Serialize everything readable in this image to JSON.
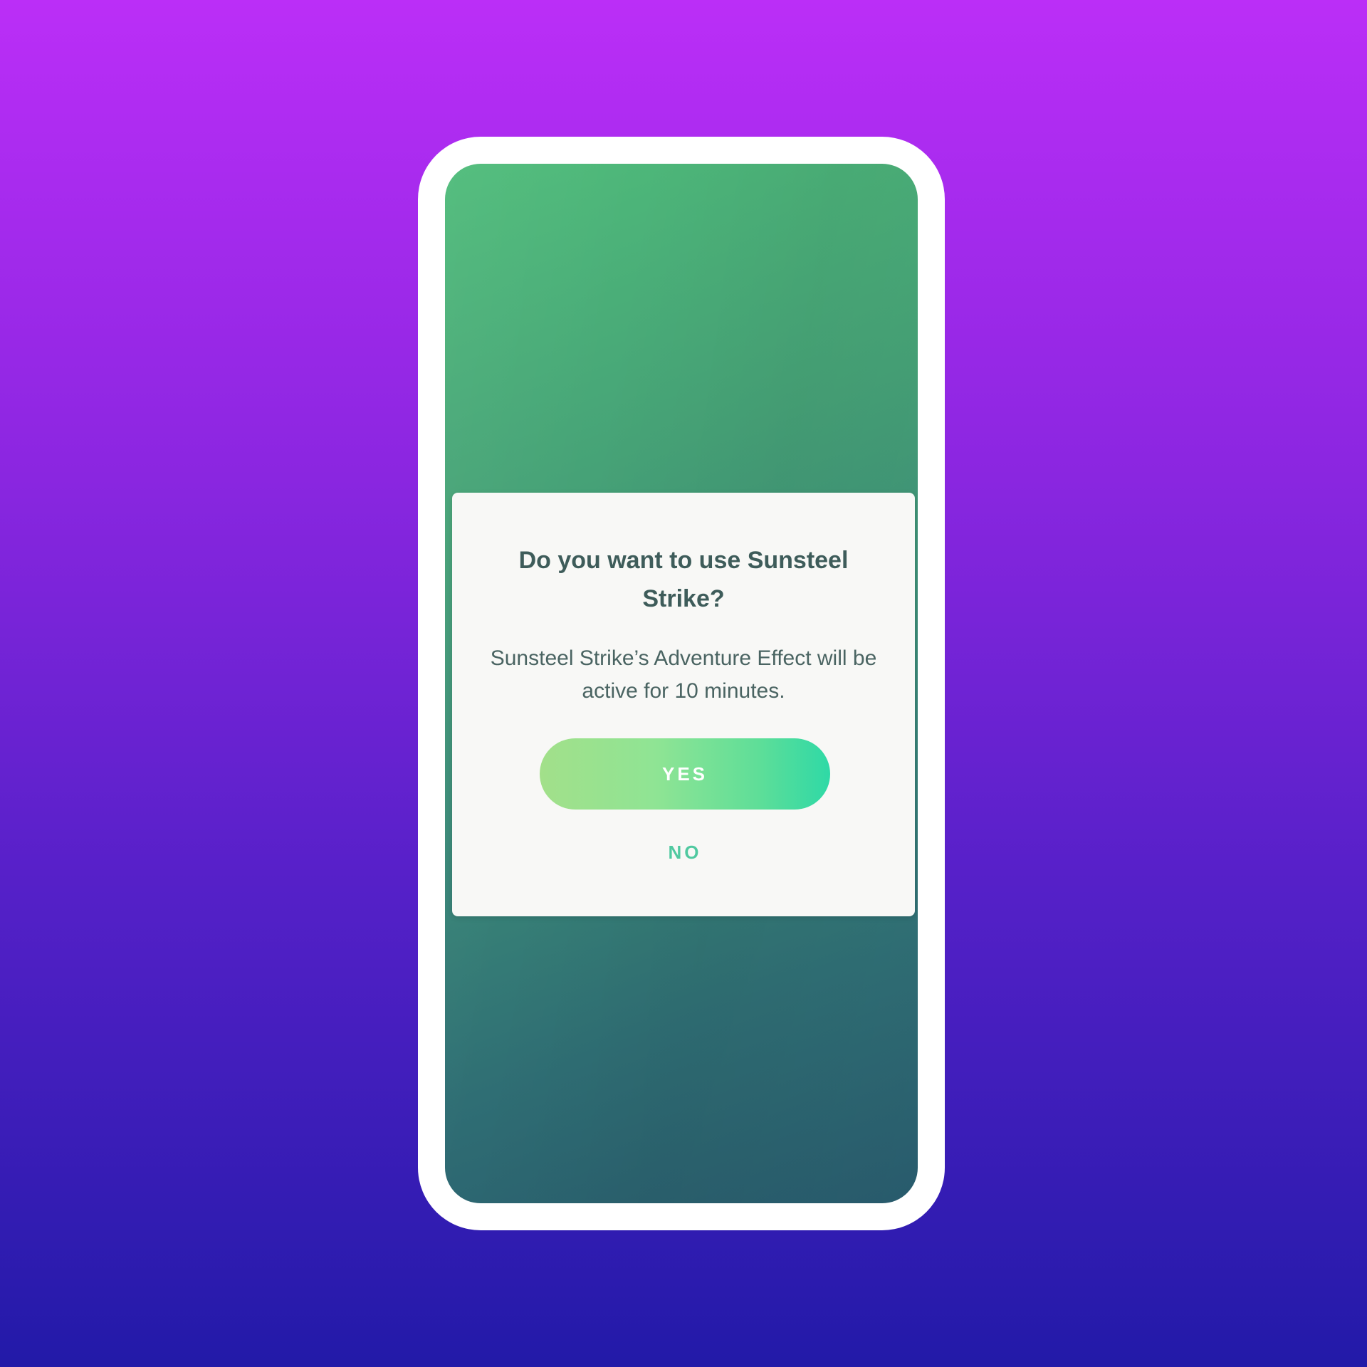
{
  "dialog": {
    "title": "Do you want to use Sunsteel Strike?",
    "body": "Sunsteel Strike’s Adventure Effect will be active for 10 minutes.",
    "confirm_label": "YES",
    "cancel_label": "NO"
  },
  "colors": {
    "background_top": "#bb2ef7",
    "background_bottom": "#221aa8",
    "screen_green": "#46a277",
    "dialog_bg": "#f8f8f6",
    "title_text": "#3e5c5a",
    "accent_green": "#50c9a0"
  }
}
